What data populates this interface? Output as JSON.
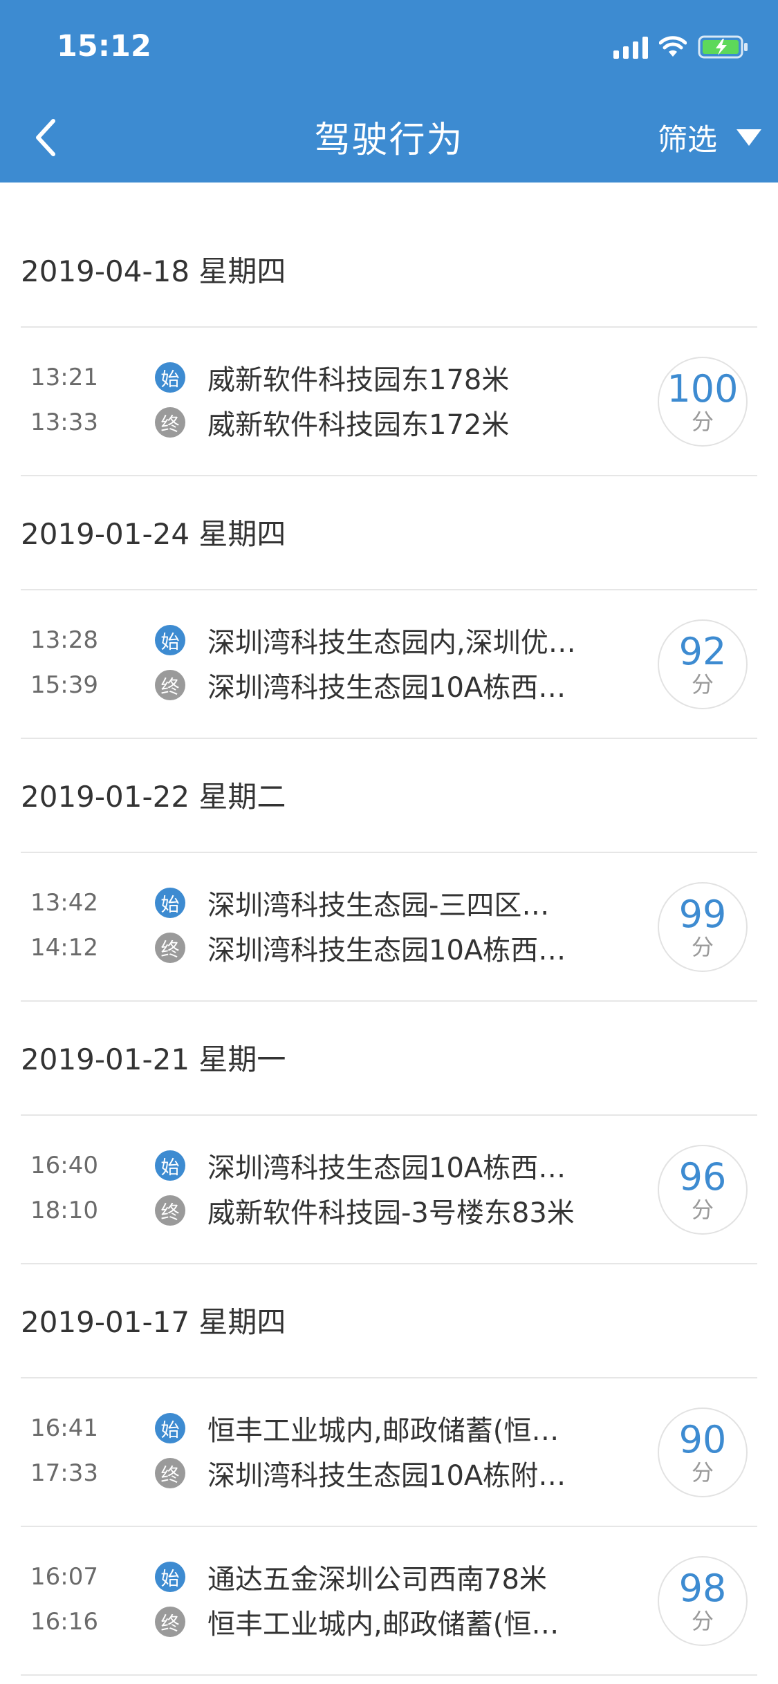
{
  "status_bar": {
    "time": "15:12"
  },
  "header": {
    "title": "驾驶行为",
    "filter_label": "筛选"
  },
  "colors": {
    "primary": "#3d8bd1",
    "end_badge": "#9a9a9a"
  },
  "groups": [
    {
      "date": "2019-04-18 星期四",
      "trips": [
        {
          "start_time": "13:21",
          "end_time": "13:33",
          "start_badge": "始",
          "end_badge": "终",
          "start_place": "威新软件科技园东178米",
          "end_place": "威新软件科技园东172米",
          "score": "100",
          "score_unit": "分"
        }
      ]
    },
    {
      "date": "2019-01-24 星期四",
      "trips": [
        {
          "start_time": "13:28",
          "end_time": "15:39",
          "start_badge": "始",
          "end_badge": "终",
          "start_place": "深圳湾科技生态园内,深圳优…",
          "end_place": "深圳湾科技生态园10A栋西…",
          "score": "92",
          "score_unit": "分"
        }
      ]
    },
    {
      "date": "2019-01-22 星期二",
      "trips": [
        {
          "start_time": "13:42",
          "end_time": "14:12",
          "start_badge": "始",
          "end_badge": "终",
          "start_place": "深圳湾科技生态园-三四区…",
          "end_place": "深圳湾科技生态园10A栋西…",
          "score": "99",
          "score_unit": "分"
        }
      ]
    },
    {
      "date": "2019-01-21 星期一",
      "trips": [
        {
          "start_time": "16:40",
          "end_time": "18:10",
          "start_badge": "始",
          "end_badge": "终",
          "start_place": "深圳湾科技生态园10A栋西…",
          "end_place": "威新软件科技园-3号楼东83米",
          "score": "96",
          "score_unit": "分"
        }
      ]
    },
    {
      "date": "2019-01-17 星期四",
      "trips": [
        {
          "start_time": "16:41",
          "end_time": "17:33",
          "start_badge": "始",
          "end_badge": "终",
          "start_place": "恒丰工业城内,邮政储蓄(恒…",
          "end_place": "深圳湾科技生态园10A栋附…",
          "score": "90",
          "score_unit": "分"
        },
        {
          "start_time": "16:07",
          "end_time": "16:16",
          "start_badge": "始",
          "end_badge": "终",
          "start_place": "通达五金深圳公司西南78米",
          "end_place": "恒丰工业城内,邮政储蓄(恒…",
          "score": "98",
          "score_unit": "分"
        }
      ]
    }
  ]
}
